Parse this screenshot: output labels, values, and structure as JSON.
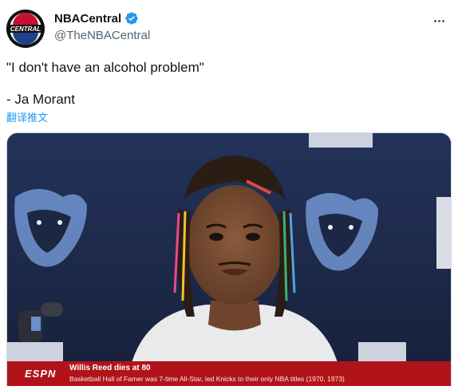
{
  "account": {
    "display_name": "NBACentral",
    "handle": "@TheNBACentral",
    "avatar_text": "CENTRAL",
    "verified": true
  },
  "tweet": {
    "line1": "\"I don't have an alcohol problem\"",
    "line2": "- Ja Morant",
    "translate_label": "翻译推文"
  },
  "media": {
    "lower_third": {
      "network": "ESPN",
      "headline": "Willis Reed dies at 80",
      "subline": "Basketball Hall of Famer was 7-time All-Star, led Knicks to their only NBA titles (1970, 1973)"
    }
  },
  "colors": {
    "link_blue": "#1d9bf0",
    "verified_blue": "#1d9bf0",
    "secondary_text": "#536471",
    "backdrop_navy": "#1c2744",
    "espn_red": "#b01419"
  }
}
